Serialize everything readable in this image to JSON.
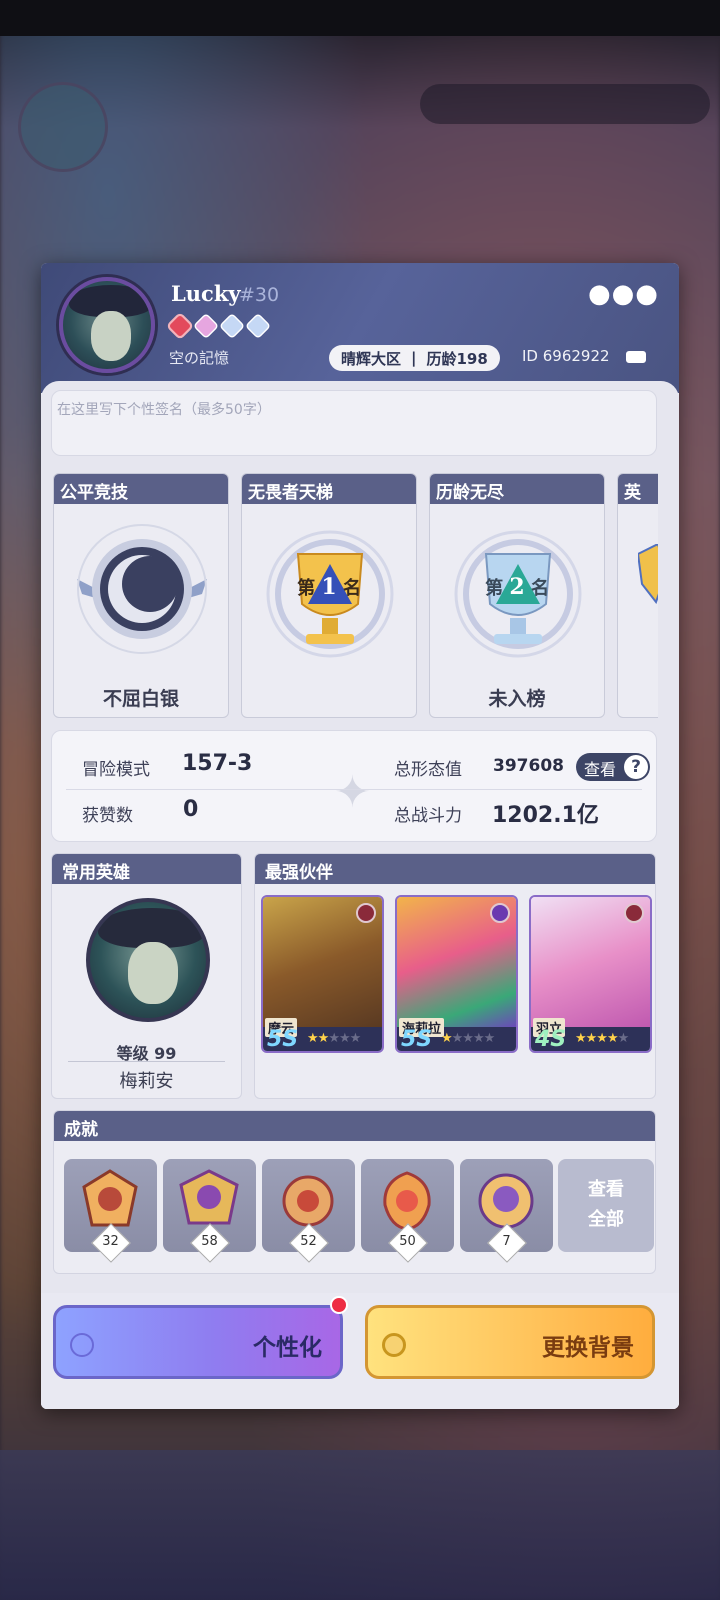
{
  "profile": {
    "name": "Lucky",
    "tag": "#30",
    "guild": "空の記憶",
    "server": "晴辉大区",
    "separator": "|",
    "age": "历龄198",
    "id": "ID 6962922",
    "more_icon": "●●●",
    "signature_placeholder": "在这里写下个性签名（最多50字）"
  },
  "ranks": [
    {
      "title": "公平竞技",
      "label": "不屈白银"
    },
    {
      "title": "无畏者天梯",
      "label": "",
      "emblem_text": "第",
      "emblem_rank": "1",
      "emblem_suffix": "名"
    },
    {
      "title": "历龄无尽",
      "label": "未入榜",
      "emblem_text": "第",
      "emblem_rank": "2",
      "emblem_suffix": "名"
    },
    {
      "title": "英"
    }
  ],
  "stats": {
    "adventure_label": "冒险模式",
    "adventure_value": "157-3",
    "likes_label": "获赞数",
    "likes_value": "0",
    "form_label": "总形态值",
    "form_value": "397608",
    "power_label": "总战斗力",
    "power_value": "1202.1亿",
    "view_label": "查看",
    "help": "?"
  },
  "hero": {
    "title": "常用英雄",
    "level": "等级 99",
    "name": "梅莉安"
  },
  "partners": {
    "title": "最强伙伴",
    "items": [
      {
        "name": "摩云",
        "grade": "5S",
        "stars": 2,
        "max": 5
      },
      {
        "name": "海莉拉",
        "grade": "5S",
        "stars": 1,
        "max": 5
      },
      {
        "name": "羽立",
        "grade": "4S",
        "stars": 4,
        "max": 5
      }
    ]
  },
  "achievements": {
    "title": "成就",
    "counts": [
      "32",
      "58",
      "52",
      "50",
      "7"
    ],
    "view_all": "查看\n全部"
  },
  "buttons": {
    "personalize": "个性化",
    "change_bg": "更换背景"
  },
  "colors": {
    "header": "#4a5482",
    "section_head": "#5a6088",
    "personalize": "#8f7df0",
    "change_bg": "#ffc25a"
  }
}
